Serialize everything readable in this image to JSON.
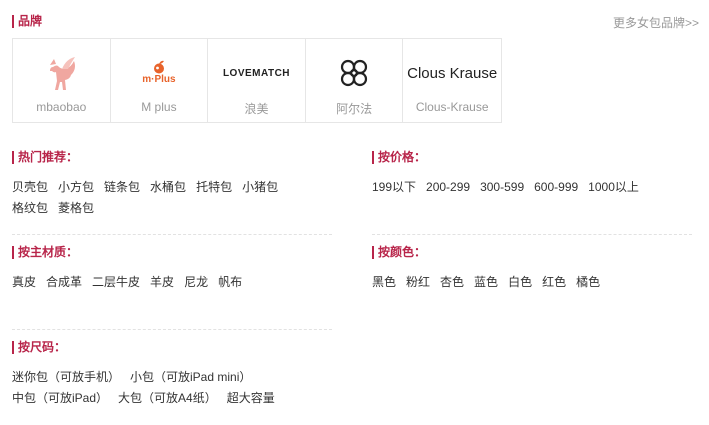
{
  "brand_section": {
    "title": "品牌",
    "more_link": "更多女包品牌>>",
    "brands": [
      {
        "name": "mbaobao",
        "logo_icon": "pink-pegasus-logo-icon"
      },
      {
        "name": "M plus",
        "logo_text": "m·Plus"
      },
      {
        "name": "浪美",
        "logo_text": "LOVEMATCH"
      },
      {
        "name": "阿尔法",
        "logo_icon": "knot-pattern-logo-icon"
      },
      {
        "name": "Clous-Krause",
        "logo_text": "Clous Krause"
      }
    ]
  },
  "hot": {
    "title": "热门推荐：",
    "items": [
      "贝壳包",
      "小方包",
      "链条包",
      "水桶包",
      "托特包",
      "小猪包",
      "格纹包",
      "菱格包"
    ]
  },
  "price": {
    "title": "按价格：",
    "items": [
      "199以下",
      "200-299",
      "300-599",
      "600-999",
      "1000以上"
    ]
  },
  "material": {
    "title": "按主材质：",
    "items": [
      "真皮",
      "合成革",
      "二层牛皮",
      "羊皮",
      "尼龙",
      "帆布"
    ]
  },
  "color": {
    "title": "按颜色：",
    "items": [
      "黑色",
      "粉红",
      "杏色",
      "蓝色",
      "白色",
      "红色",
      "橘色"
    ]
  },
  "size": {
    "title": "按尺码：",
    "items": [
      "迷你包（可放手机）",
      "小包（可放iPad mini）",
      "中包（可放iPad）",
      "大包（可放A4纸）",
      "超大容量"
    ]
  },
  "colors": {
    "accent": "#b8254a",
    "mplus_orange": "#e8632b",
    "pegasus_pink": "#f0a7a0"
  }
}
